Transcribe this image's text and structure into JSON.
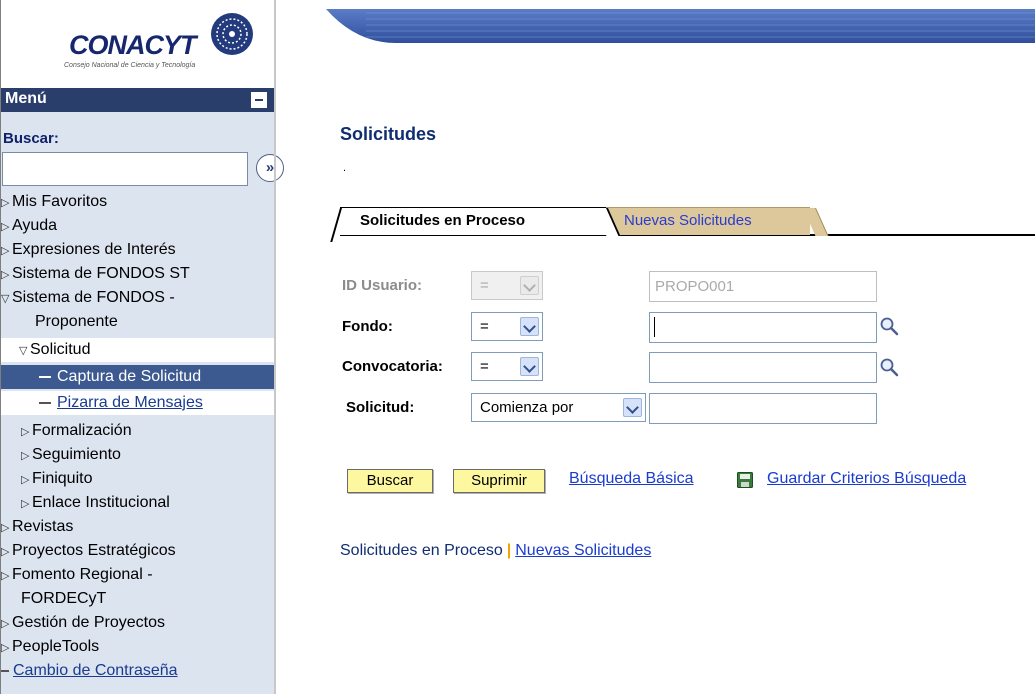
{
  "logo": {
    "name": "CONACYT",
    "subtitle": "Consejo Nacional de Ciencia y Tecnología"
  },
  "menu": {
    "title": "Menú",
    "search_label": "Buscar:",
    "search_value": "",
    "items": [
      {
        "label": "Mis Favoritos"
      },
      {
        "label": "Ayuda"
      },
      {
        "label": "Expresiones de Interés"
      },
      {
        "label": "Sistema de FONDOS ST"
      },
      {
        "label": "Sistema de FONDOS -"
      },
      {
        "label": "Proponente"
      },
      {
        "label": "Solicitud"
      },
      {
        "label": "Captura de Solicitud"
      },
      {
        "label": "Pizarra de Mensajes"
      },
      {
        "label": "Formalización"
      },
      {
        "label": "Seguimiento"
      },
      {
        "label": "Finiquito"
      },
      {
        "label": "Enlace Institucional"
      },
      {
        "label": "Revistas"
      },
      {
        "label": "Proyectos Estratégicos"
      },
      {
        "label": "Fomento Regional -"
      },
      {
        "label": "FORDECyT"
      },
      {
        "label": "Gestión de Proyectos"
      },
      {
        "label": "PeopleTools"
      },
      {
        "label": "Cambio de Contraseña"
      }
    ]
  },
  "page": {
    "title": "Solicitudes",
    "dot": "."
  },
  "tabs": {
    "active": "Solicitudes en Proceso",
    "other": "Nuevas Solicitudes"
  },
  "form": {
    "id_usuario": {
      "label": "ID Usuario:",
      "operator": "=",
      "value": "PROPO001"
    },
    "fondo": {
      "label": "Fondo:",
      "operator": "=",
      "value": ""
    },
    "convocatoria": {
      "label": "Convocatoria:",
      "operator": "=",
      "value": ""
    },
    "solicitud": {
      "label": "Solicitud:",
      "operator": "Comienza por",
      "value": ""
    }
  },
  "actions": {
    "buscar": "Buscar",
    "suprimir": "Suprimir",
    "busqueda_basica": "Búsqueda Básica",
    "guardar_criterios": "Guardar Criterios Búsqueda"
  },
  "bottom_nav": {
    "current": "Solicitudes en Proceso",
    "separator": "|",
    "link": "Nuevas Solicitudes"
  },
  "colors": {
    "menu_header": "#2a3e6b",
    "menu_bg": "#dce4f0",
    "selected_item": "#3c5a90",
    "title": "#102d72",
    "button_bg": "#fdf8a0",
    "inactive_tab": "#dcc89a"
  }
}
